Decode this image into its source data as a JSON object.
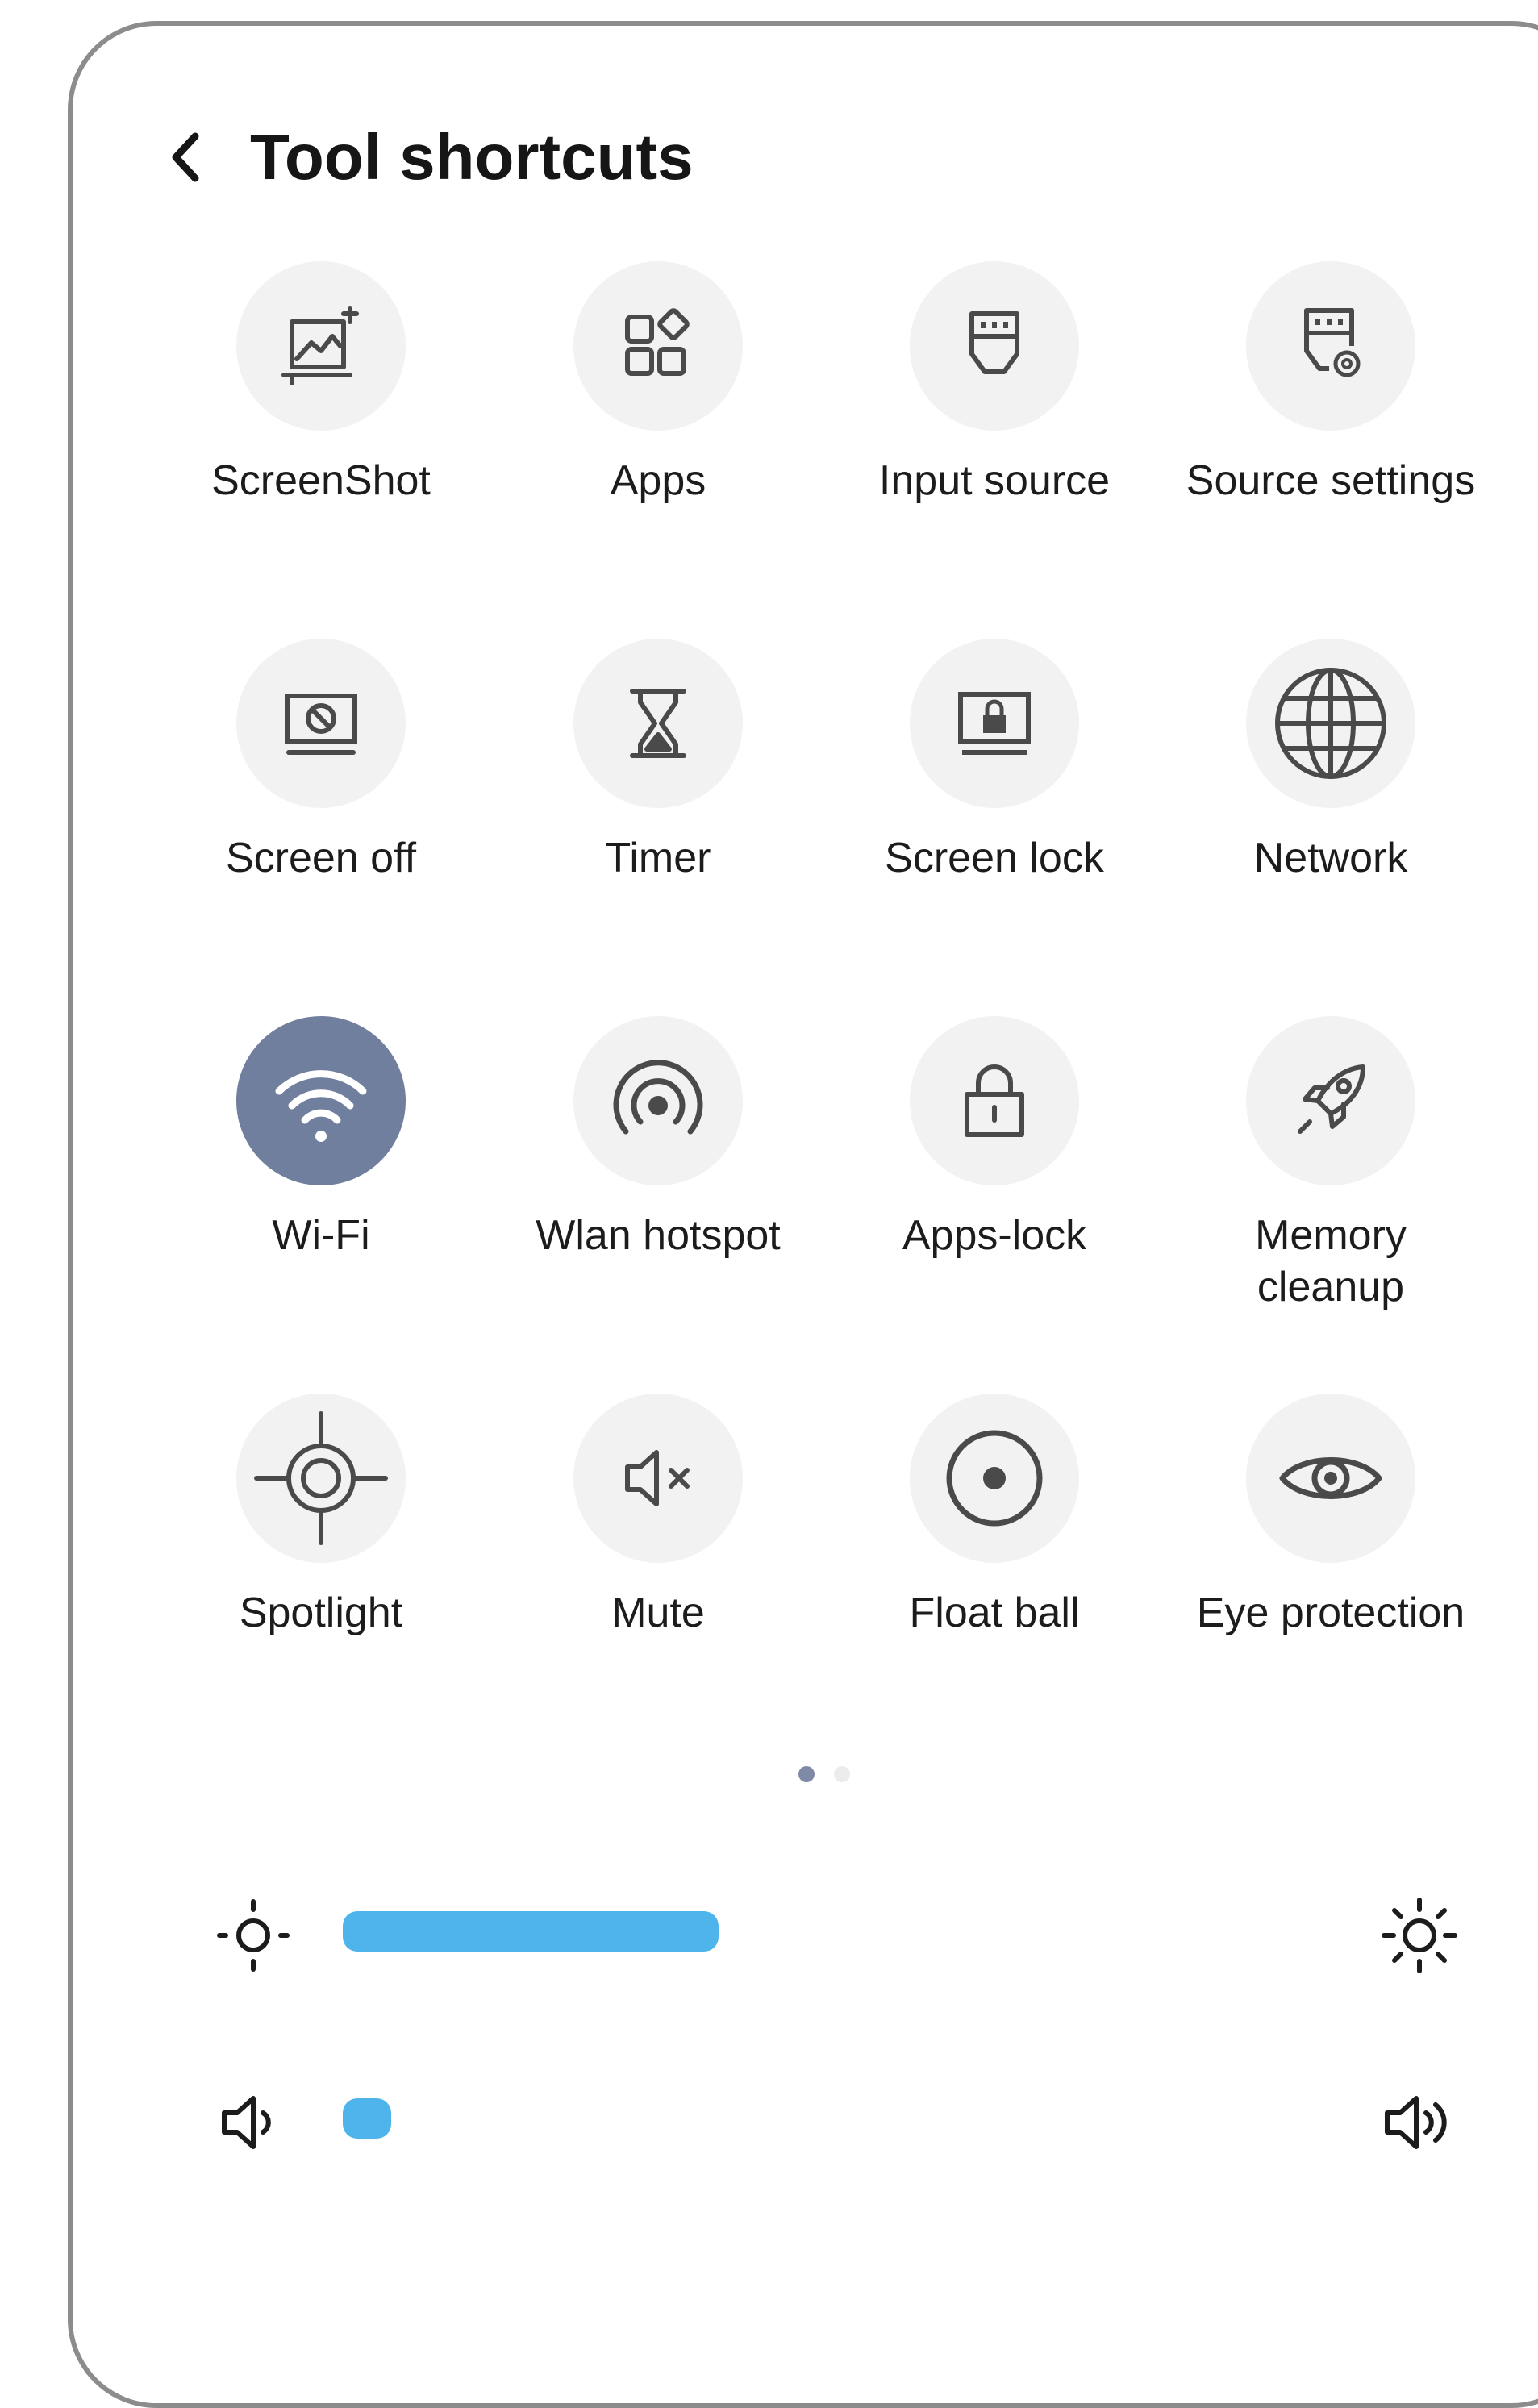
{
  "header": {
    "title": "Tool shortcuts",
    "back_icon": "chevron-left-icon"
  },
  "shortcuts": [
    {
      "label": "ScreenShot",
      "icon": "screenshot-icon",
      "active": false
    },
    {
      "label": "Apps",
      "icon": "apps-icon",
      "active": false
    },
    {
      "label": "Input source",
      "icon": "input-source-icon",
      "active": false
    },
    {
      "label": "Source settings",
      "icon": "source-settings-icon",
      "active": false
    },
    {
      "label": "Screen off",
      "icon": "screen-off-icon",
      "active": false
    },
    {
      "label": "Timer",
      "icon": "hourglass-icon",
      "active": false
    },
    {
      "label": "Screen lock",
      "icon": "screen-lock-icon",
      "active": false
    },
    {
      "label": "Network",
      "icon": "globe-icon",
      "active": false
    },
    {
      "label": "Wi-Fi",
      "icon": "wifi-icon",
      "active": true
    },
    {
      "label": "Wlan hotspot",
      "icon": "hotspot-icon",
      "active": false
    },
    {
      "label": "Apps-lock",
      "icon": "lock-icon",
      "active": false
    },
    {
      "label": "Memory\ncleanup",
      "icon": "rocket-icon",
      "active": false
    },
    {
      "label": "Spotlight",
      "icon": "spotlight-icon",
      "active": false
    },
    {
      "label": "Mute",
      "icon": "mute-icon",
      "active": false
    },
    {
      "label": "Float ball",
      "icon": "float-ball-icon",
      "active": false
    },
    {
      "label": "Eye protection",
      "icon": "eye-icon",
      "active": false
    }
  ],
  "pager": {
    "pages": 2,
    "current": 1
  },
  "brightness": {
    "icon_low": "brightness-low-icon",
    "icon_high": "brightness-high-icon",
    "level": 0.34
  },
  "volume": {
    "icon_low": "volume-low-icon",
    "icon_high": "volume-high-icon",
    "level": 0.02
  },
  "colors": {
    "accent": "#4fb4ec",
    "active_tile": "#717f9e",
    "tile_bg": "#f2f2f2",
    "text": "#1c1c1c"
  }
}
